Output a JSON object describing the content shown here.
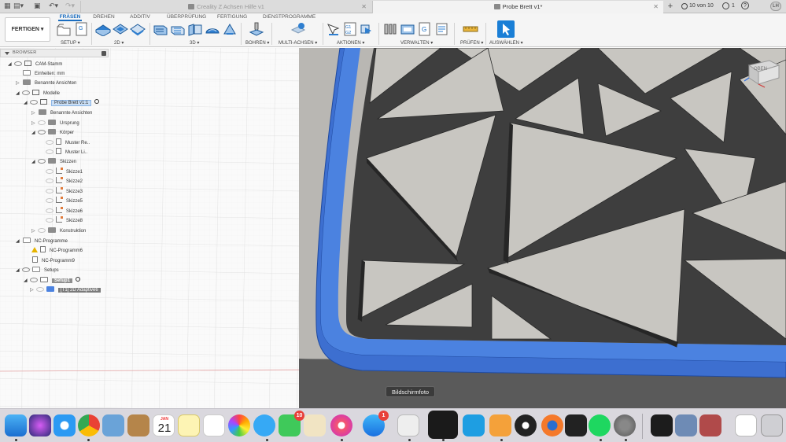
{
  "tabs": {
    "inactive_title": "Creality Z Achsen Hilfe v1",
    "active_title": "Probe Brett v1*",
    "tab_count": "10 von 10",
    "notifications": "1",
    "user_initials": "LH"
  },
  "ribbon": {
    "workspace": "FERTIGEN",
    "tabs": [
      "FRÄSEN",
      "DREHEN",
      "ADDITIV",
      "ÜBERPRÜFUNG",
      "FERTIGUNG",
      "DIENSTPROGRAMME"
    ],
    "groups": {
      "setup": "SETUP",
      "twod": "2D",
      "threed": "3D",
      "bohren": "BOHREN",
      "multiachsen": "MULTI-ACHSEN",
      "aktionen": "AKTIONEN",
      "verwalten": "VERWALTEN",
      "pruefen": "PRÜFEN",
      "auswaehlen": "AUSWÄHLEN"
    }
  },
  "browser": {
    "title": "BROWSER",
    "rows": [
      "CAM-Stamm",
      "Einheiten: mm",
      "Benannte Ansichten",
      "Modelle",
      "Probe Brett v1:1",
      "Benannte Ansichten",
      "Ursprung",
      "Körper",
      "Muster Re..",
      "Muster Li..",
      "Skizzen",
      "Skizze1",
      "Skizze2",
      "Skizze3",
      "Skizze5",
      "Skizze6",
      "Skizze8",
      "Konstruktion",
      "NC-Programme",
      "NC-Programm6",
      "NC-Programm9",
      "Setups",
      "Setup1",
      "[T1] 2D Adaptive6"
    ]
  },
  "viewcube": {
    "label": "OBEN"
  },
  "tooltip": "Bildschirmfoto",
  "dock": {
    "calendar_month": "JAN",
    "calendar_day": "21",
    "badges": {
      "messages": "10",
      "app_store": "1"
    }
  }
}
